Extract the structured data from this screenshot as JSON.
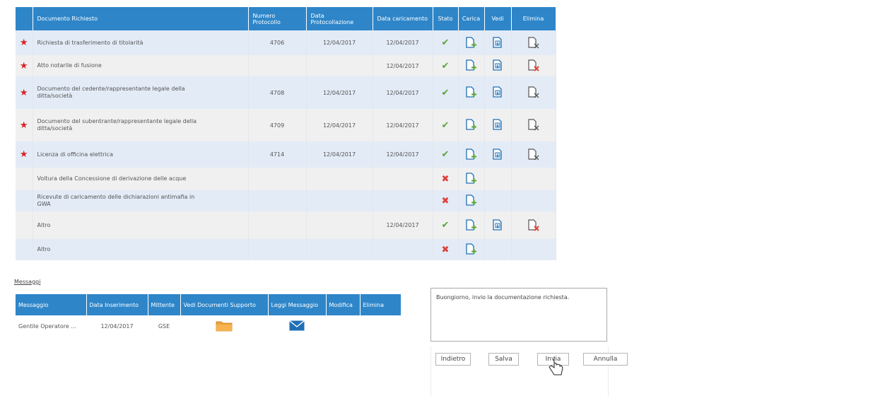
{
  "documents": {
    "headers": {
      "doc": "Documento Richiesto",
      "numero": "Numero Protocollo",
      "data_prot": "Data Protocollazione",
      "data_car": "Data caricamento",
      "stato": "Stato",
      "carica": "Carica",
      "vedi": "Vedi",
      "elimina": "Elimina"
    },
    "rows": [
      {
        "required": true,
        "name": "Richiesta di trasferimento di titolarità",
        "numero": "4706",
        "data_prot": "12/04/2017",
        "data_car": "12/04/2017",
        "stato": "ok",
        "vedi": true,
        "elimina": "grey"
      },
      {
        "required": true,
        "name": "Atto notarile di fusione",
        "numero": "",
        "data_prot": "",
        "data_car": "12/04/2017",
        "stato": "ok",
        "vedi": true,
        "elimina": "red"
      },
      {
        "required": true,
        "name": "Documento del cedente/rappresentante legale della ditta/società",
        "numero": "4708",
        "data_prot": "12/04/2017",
        "data_car": "12/04/2017",
        "stato": "ok",
        "vedi": true,
        "elimina": "grey"
      },
      {
        "required": true,
        "name": "Documento del subentrante/rappresentante legale della ditta/società",
        "numero": "4709",
        "data_prot": "12/04/2017",
        "data_car": "12/04/2017",
        "stato": "ok",
        "vedi": true,
        "elimina": "grey"
      },
      {
        "required": true,
        "name": "Licenza di officina elettrica",
        "numero": "4714",
        "data_prot": "12/04/2017",
        "data_car": "12/04/2017",
        "stato": "ok",
        "vedi": true,
        "elimina": "grey"
      },
      {
        "required": false,
        "name": "Voltura della Concessione di derivazione delle acque",
        "numero": "",
        "data_prot": "",
        "data_car": "",
        "stato": "ko",
        "vedi": false,
        "elimina": "none"
      },
      {
        "required": false,
        "name": "Ricevute di caricamento delle dichiarazioni antimafia in GWA",
        "numero": "",
        "data_prot": "",
        "data_car": "",
        "stato": "ko",
        "vedi": false,
        "elimina": "none"
      },
      {
        "required": false,
        "name": "Altro",
        "numero": "",
        "data_prot": "",
        "data_car": "12/04/2017",
        "stato": "ok",
        "vedi": true,
        "elimina": "red"
      },
      {
        "required": false,
        "name": "Altro",
        "numero": "",
        "data_prot": "",
        "data_car": "",
        "stato": "ko",
        "vedi": false,
        "elimina": "none"
      }
    ]
  },
  "messages": {
    "title": "Messaggi",
    "headers": {
      "messaggio": "Messaggio",
      "data": "Data Inserimento",
      "mittente": "Mittente",
      "vedi_doc": "Vedi Documenti Supporto",
      "leggi": "Leggi Messaggio",
      "modifica": "Modifica",
      "elimina": "Elimina"
    },
    "rows": [
      {
        "messaggio": "Gentile Operatore ...",
        "data": "12/04/2017",
        "mittente": "GSE"
      }
    ]
  },
  "reply": {
    "text": "Buongiorno, invio la documentazione richiesta."
  },
  "buttons": {
    "indietro": "Indietro",
    "salva": "Salva",
    "invia": "Invia",
    "annulla": "Annulla"
  },
  "colors": {
    "header_bg": "#2e86c9",
    "row_alt_a": "#e3ebf6",
    "row_alt_b": "#f0f0f0",
    "star": "#d8232a",
    "ok": "#5aa53a",
    "ko": "#e0403a",
    "icon_stroke": "#1f6fb5"
  },
  "icons": {
    "required": "star-icon",
    "ok": "checkmark-icon",
    "ko": "cross-icon",
    "upload": "upload-document-icon",
    "view": "view-document-icon",
    "delete": "delete-document-icon",
    "folder": "folder-icon",
    "mail": "envelope-icon",
    "cursor": "mouse-pointer-icon"
  }
}
